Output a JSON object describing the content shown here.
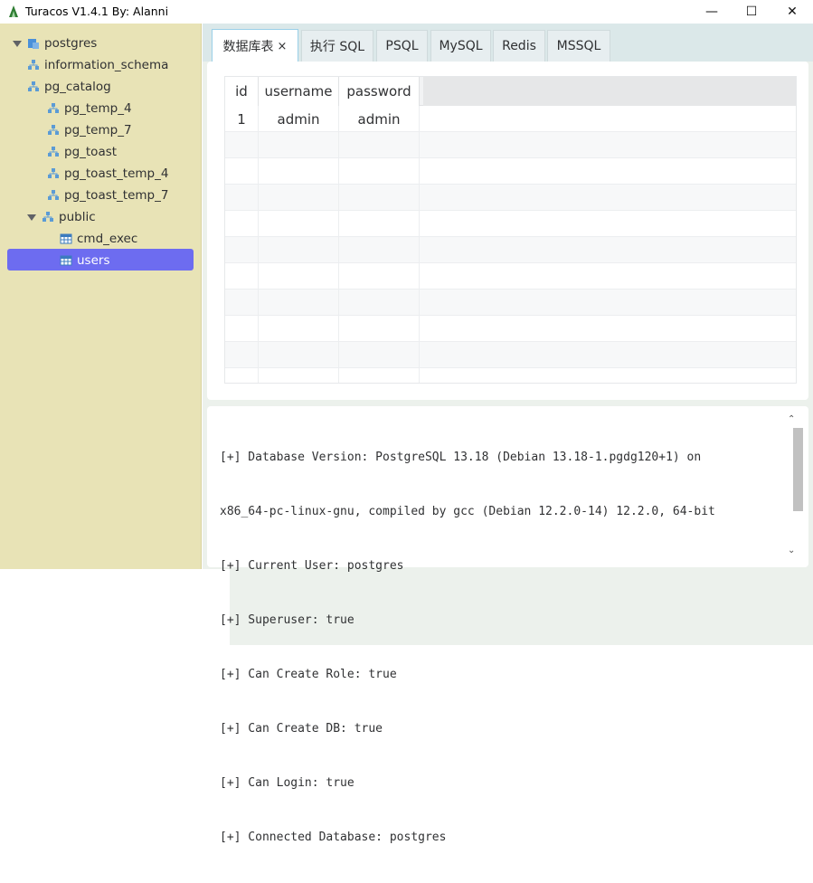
{
  "window": {
    "title": "Turacos V1.4.1 By: Alanni",
    "minimize": "—",
    "maximize": "☐",
    "close": "✕"
  },
  "tree": {
    "root": "postgres",
    "schemas": [
      {
        "label": "information_schema",
        "expandable": true
      },
      {
        "label": "pg_catalog",
        "expandable": true
      },
      {
        "label": "pg_temp_4",
        "expandable": false
      },
      {
        "label": "pg_temp_7",
        "expandable": false
      },
      {
        "label": "pg_toast",
        "expandable": false
      },
      {
        "label": "pg_toast_temp_4",
        "expandable": false
      },
      {
        "label": "pg_toast_temp_7",
        "expandable": false
      },
      {
        "label": "public",
        "expandable": true
      }
    ],
    "tables": [
      {
        "label": "cmd_exec",
        "selected": false
      },
      {
        "label": "users",
        "selected": true
      }
    ]
  },
  "tabs": [
    {
      "label": "数据库表",
      "closable": true,
      "active": true
    },
    {
      "label": "执行 SQL"
    },
    {
      "label": "PSQL"
    },
    {
      "label": "MySQL"
    },
    {
      "label": "Redis"
    },
    {
      "label": "MSSQL"
    }
  ],
  "tab_close": "×",
  "grid": {
    "columns": [
      "id",
      "username",
      "password"
    ],
    "rows": [
      [
        "1",
        "admin",
        "admin"
      ]
    ]
  },
  "console": {
    "lines": [
      "[+] Database Version: PostgreSQL 13.18 (Debian 13.18-1.pgdg120+1) on",
      "x86_64-pc-linux-gnu, compiled by gcc (Debian 12.2.0-14) 12.2.0, 64-bit",
      "[+] Current User: postgres",
      "[+] Superuser: true",
      "[+] Can Create Role: true",
      "[+] Can Create DB: true",
      "[+] Can Login: true",
      "[+] Connected Database: postgres"
    ]
  },
  "colors": {
    "sidebar_bg": "#e8e3b6",
    "selection": "#6d6cf0",
    "tabbar_bg": "#dbe8e9"
  }
}
